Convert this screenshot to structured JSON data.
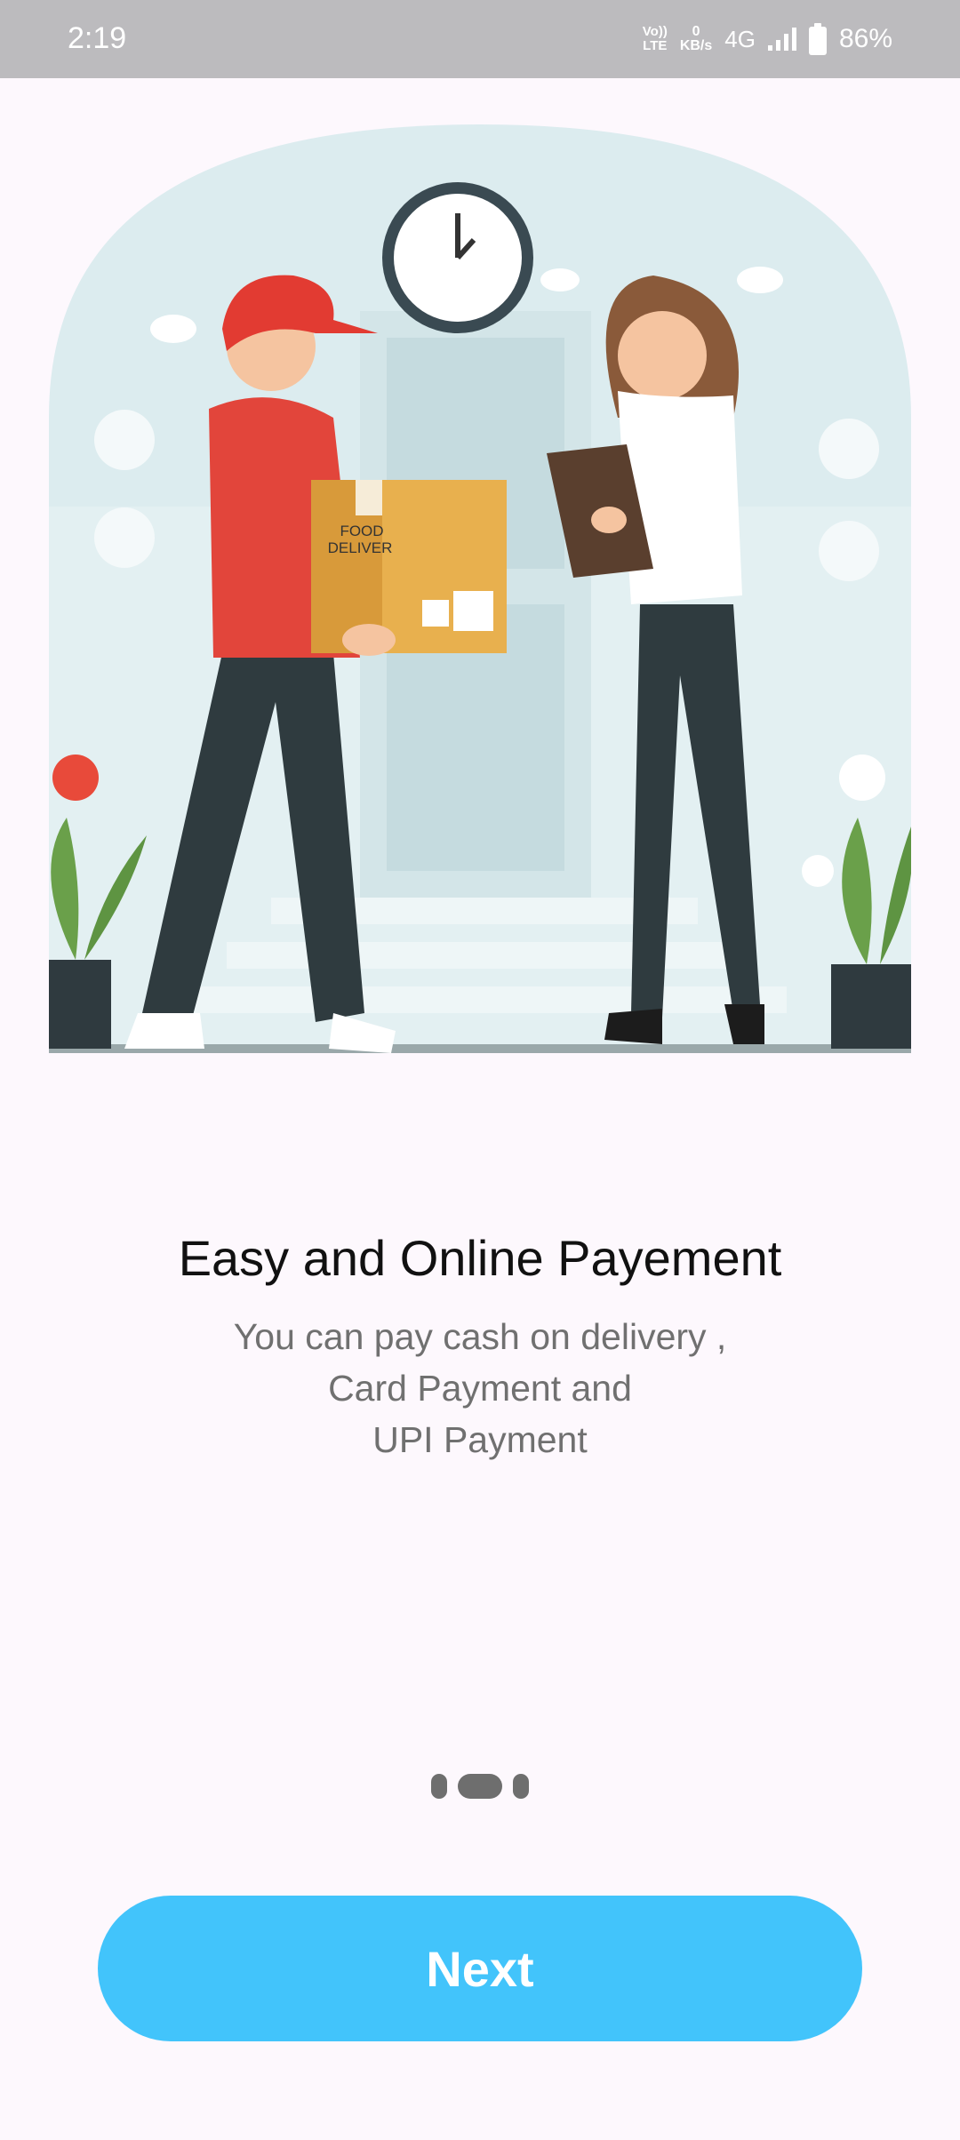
{
  "status_bar": {
    "time": "2:19",
    "volte_line1": "Vo))",
    "volte_line2": "LTE",
    "speed_value": "0",
    "speed_unit": "KB/s",
    "network": "4G",
    "battery": "86%",
    "icons": [
      "volte-icon",
      "signal-icon",
      "battery-icon"
    ]
  },
  "illustration": {
    "box_label_line1": "FOOD",
    "box_label_line2": "DELIVER"
  },
  "onboarding": {
    "title": "Easy and Online Payement",
    "description_lines": [
      "You can pay cash on delivery ,",
      "Card Payment and",
      "UPI Payment"
    ],
    "page_count": 3,
    "active_page": 2,
    "next_label": "Next"
  },
  "colors": {
    "button": "#42c4fb",
    "status_bar": "#bcbbbe",
    "background": "#fdf8fd",
    "dots": "#6e6e6e"
  }
}
